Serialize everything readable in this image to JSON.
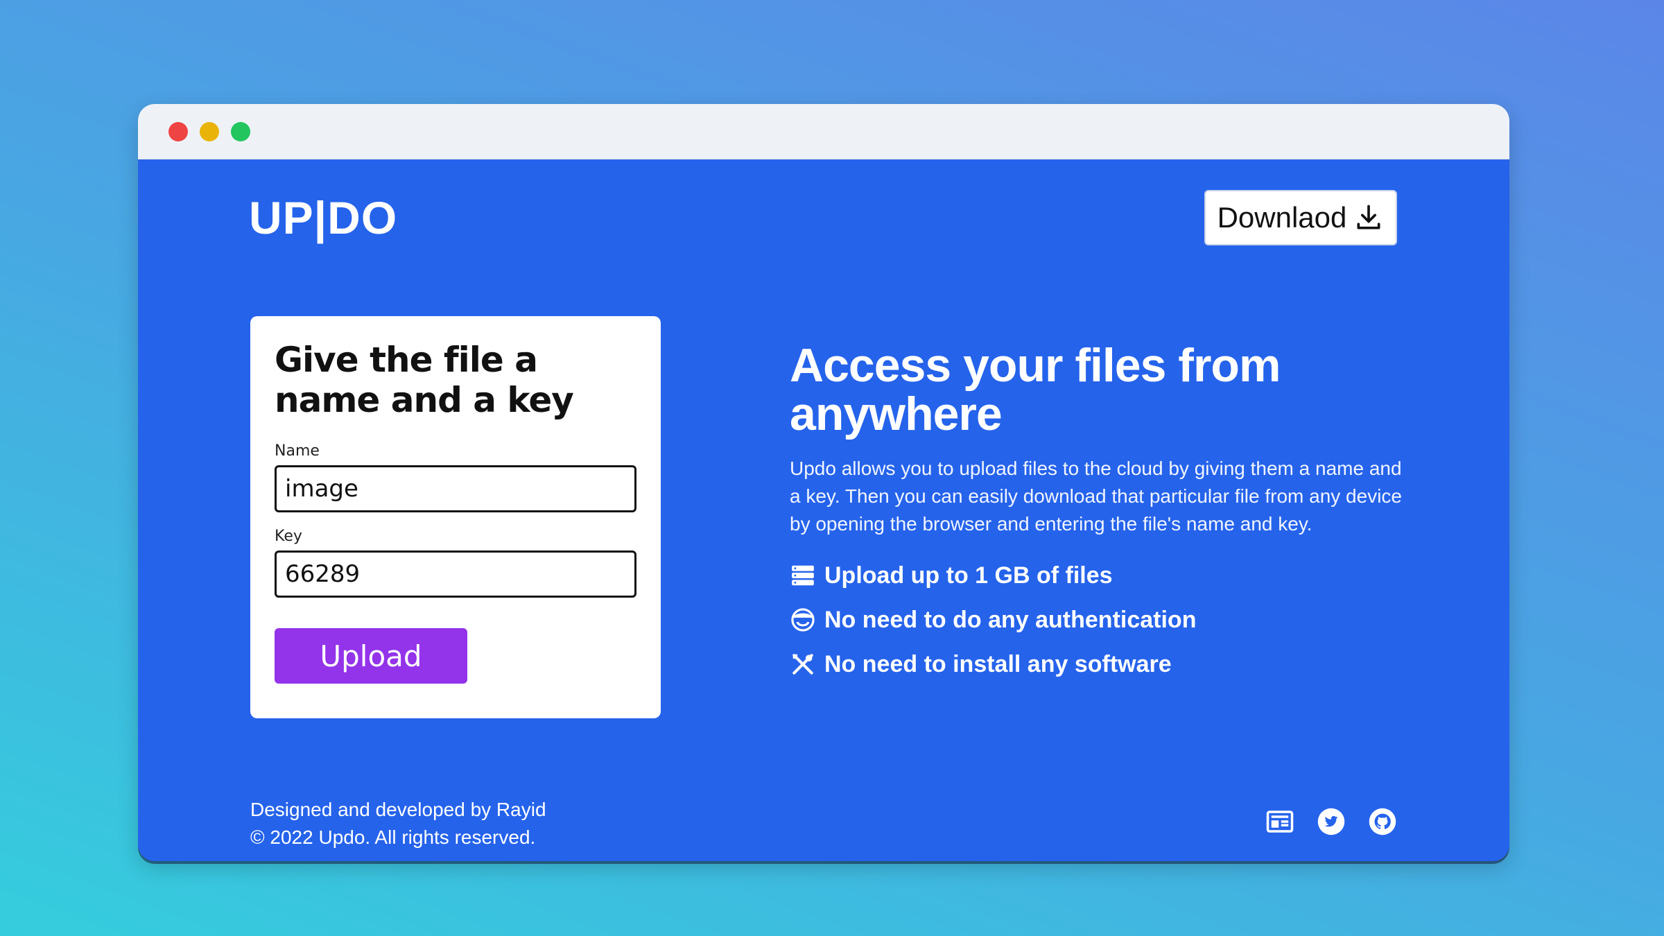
{
  "header": {
    "logo": "UP|DO",
    "download_label": "Downlaod"
  },
  "form": {
    "title": "Give the file a name and a key",
    "name_label": "Name",
    "name_value": "image",
    "key_label": "Key",
    "key_value": "66289",
    "upload_label": "Upload"
  },
  "hero": {
    "title": "Access your files from anywhere",
    "description": "Updo allows you to upload files to the cloud by giving them a name and a key. Then you can easily download that particular file from any device by opening the browser and entering the file's name and key.",
    "features": [
      {
        "icon": "server-icon",
        "label": "Upload up to 1 GB of files"
      },
      {
        "icon": "user-shield-icon",
        "label": "No need to do any authentication"
      },
      {
        "icon": "tools-icon",
        "label": "No need to install any software"
      }
    ]
  },
  "footer": {
    "credit": "Designed and developed by Rayid",
    "copyright": "© 2022 Updo. All rights reserved.",
    "icons": [
      "blog-icon",
      "twitter-icon",
      "github-icon"
    ]
  },
  "colors": {
    "page_background": "#2563eb",
    "upload_button": "#9333ea",
    "titlebar": "#eef2f7"
  }
}
